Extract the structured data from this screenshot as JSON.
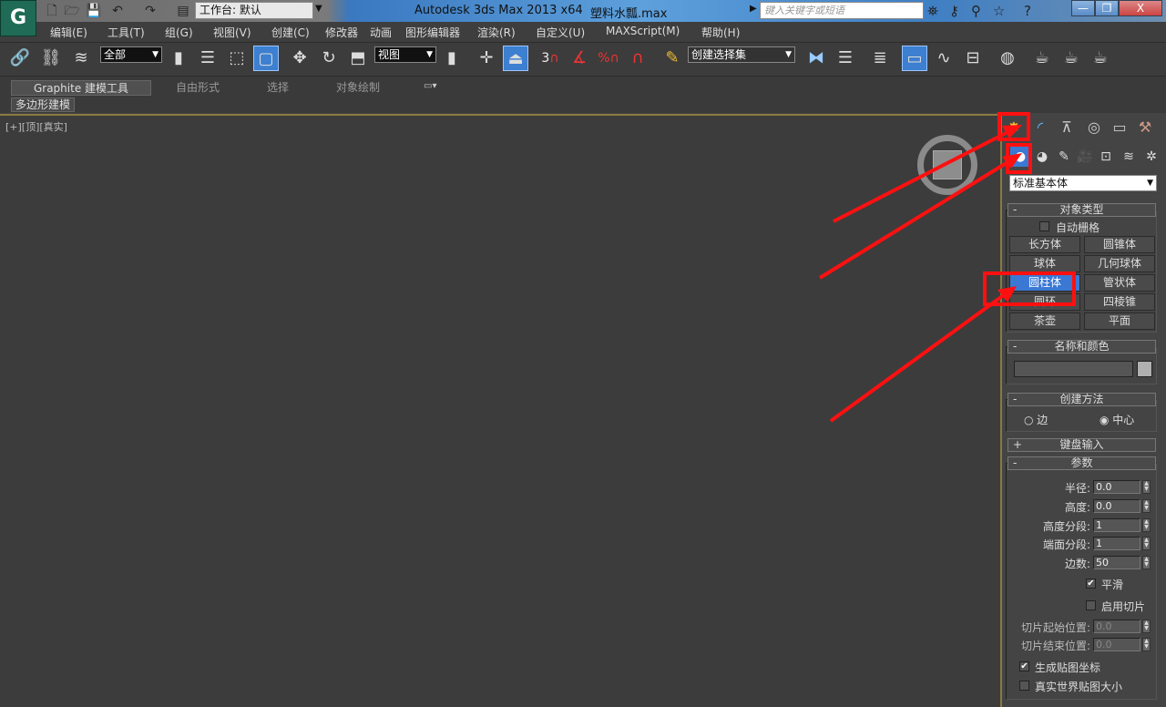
{
  "titlebar": {
    "workspace": "工作台: 默认",
    "app_title": "Autodesk 3ds Max  2013 x64",
    "file": "塑料水瓢.max",
    "search_placeholder": "键入关键字或短语",
    "minimize": "—",
    "restore": "❐",
    "close": "X"
  },
  "menu": [
    "编辑(E)",
    "工具(T)",
    "组(G)",
    "视图(V)",
    "创建(C)",
    "修改器",
    "动画",
    "图形编辑器",
    "渲染(R)",
    "自定义(U)",
    "MAXScript(M)",
    "帮助(H)"
  ],
  "toolbar": {
    "selection_filter": "全部",
    "ref_coord": "视图",
    "named_selection": "创建选择集",
    "snap_label": "3"
  },
  "ribbon": {
    "tabs": [
      "Graphite 建模工具",
      "自由形式",
      "选择",
      "对象绘制"
    ],
    "subtab": "多边形建模"
  },
  "viewport": {
    "label": "[+][顶][真实]"
  },
  "command_panel": {
    "category": "标准基本体",
    "object_type": {
      "title": "对象类型",
      "autogrid": "自动栅格",
      "buttons": [
        "长方体",
        "圆锥体",
        "球体",
        "几何球体",
        "圆柱体",
        "管状体",
        "圆环",
        "四棱锥",
        "茶壶",
        "平面"
      ],
      "active": "圆柱体"
    },
    "name_color": {
      "title": "名称和颜色",
      "name_value": ""
    },
    "creation_method": {
      "title": "创建方法",
      "options": [
        "边",
        "中心"
      ],
      "selected": "中心"
    },
    "keyboard_entry": {
      "title": "键盘输入"
    },
    "parameters": {
      "title": "参数",
      "fields": [
        {
          "label": "半径:",
          "value": "0.0"
        },
        {
          "label": "高度:",
          "value": "0.0"
        },
        {
          "label": "高度分段:",
          "value": "1"
        },
        {
          "label": "端面分段:",
          "value": "1"
        },
        {
          "label": "边数:",
          "value": "50"
        }
      ],
      "smooth": "平滑",
      "smooth_checked": true,
      "slice_on": "启用切片",
      "slice_checked": false,
      "slice_from": {
        "label": "切片起始位置:",
        "value": "0.0"
      },
      "slice_to": {
        "label": "切片结束位置:",
        "value": "0.0"
      },
      "gen_mapping": "生成贴图坐标",
      "gen_mapping_checked": true,
      "real_world": "真实世界贴图大小",
      "real_world_checked": false
    }
  },
  "annotation_color": "#ff1010"
}
